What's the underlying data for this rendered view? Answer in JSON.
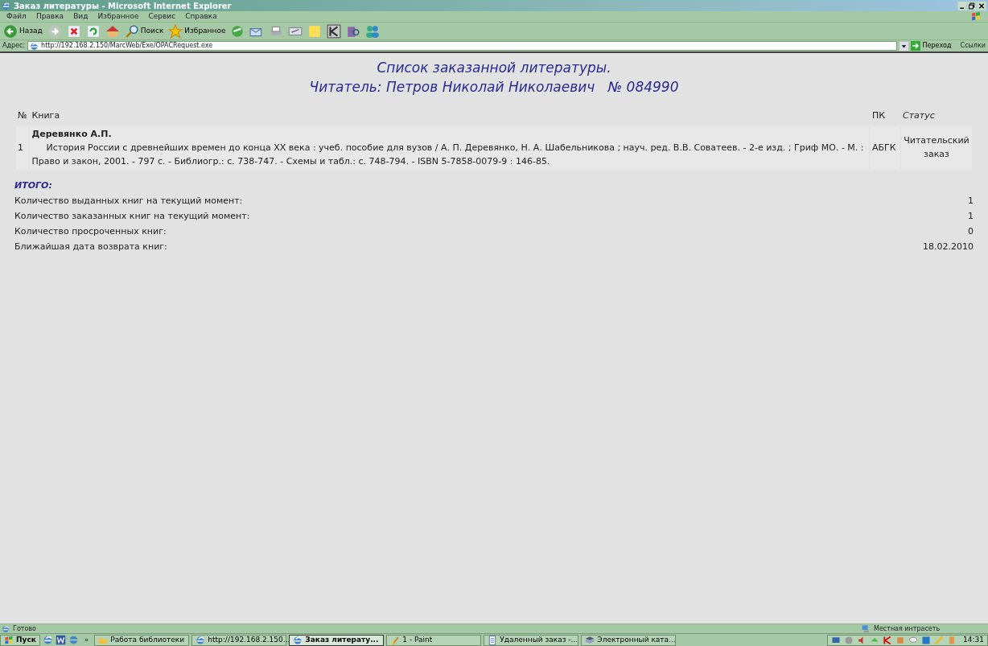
{
  "window": {
    "title": "Заказ литературы - Microsoft Internet Explorer"
  },
  "menu": [
    "Файл",
    "Правка",
    "Вид",
    "Избранное",
    "Сервис",
    "Справка"
  ],
  "toolbar": [
    {
      "kind": "back",
      "label": "Назад"
    },
    {
      "kind": "forward"
    },
    {
      "kind": "stop"
    },
    {
      "kind": "refresh"
    },
    {
      "kind": "home"
    },
    {
      "kind": "search",
      "label": "Поиск"
    },
    {
      "kind": "favorites",
      "label": "Избранное"
    },
    {
      "kind": "media"
    },
    {
      "kind": "mail"
    },
    {
      "kind": "print"
    },
    {
      "kind": "edit"
    },
    {
      "kind": "note"
    },
    {
      "kind": "k"
    },
    {
      "kind": "research"
    },
    {
      "kind": "messenger"
    }
  ],
  "address": {
    "label": "Адрес:",
    "url": "http://192.168.2.150/MarcWeb/Exe/OPACRequest.exe",
    "go": "Переход",
    "links": "Ссылки"
  },
  "page": {
    "heading": [
      "Список заказанной литературы.",
      "Читатель: Петров Николай Николаевич   № 084990"
    ],
    "table": {
      "columns": [
        "№",
        "Книга",
        "ПК",
        "Статус"
      ],
      "rows": [
        {
          "number": "1",
          "author": "Деревянко А.П.",
          "description": "История России с древнейших времен до конца XX века : учеб. пособие для вузов / А. П. Деревянко, Н. А. Шабельникова ; науч. ред. В.В. Соватеев. - 2-е изд. ; Гриф МО. - М. : Право и закон, 2001. - 797 с. - Библиогр.: с. 738-747. - Схемы и табл.: с. 748-794. - ISBN 5-7858-0079-9 : 146-85.",
          "pk": "АБГК",
          "status": "Читательский заказ"
        }
      ]
    },
    "totals_title": "ИТОГО:",
    "totals": [
      {
        "label": "Количество выданных книг на текущий момент:",
        "value": "1"
      },
      {
        "label": "Количество заказанных книг на текущий момент:",
        "value": "1"
      },
      {
        "label": "Количество просроченных книг:",
        "value": "0"
      },
      {
        "label": "Ближайшая дата возврата книг:",
        "value": "18.02.2010"
      }
    ]
  },
  "status_bar": {
    "text": "Готово",
    "zone": "Местная интрасеть"
  },
  "taskbar": {
    "start": "Пуск",
    "more": "»",
    "tasks": [
      {
        "label": "Работа библиотеки",
        "kind": "folder",
        "selected": false
      },
      {
        "label": "http://192.168.2.150...",
        "kind": "ie",
        "selected": false
      },
      {
        "label": "Заказ литерату...",
        "kind": "ie",
        "selected": true
      },
      {
        "label": "1 - Paint",
        "kind": "paint",
        "selected": false
      },
      {
        "label": "Удаленный заказ -...",
        "kind": "doc",
        "selected": false
      },
      {
        "label": "Электронный ката...",
        "kind": "book",
        "selected": false
      }
    ],
    "clock": "14:31"
  }
}
